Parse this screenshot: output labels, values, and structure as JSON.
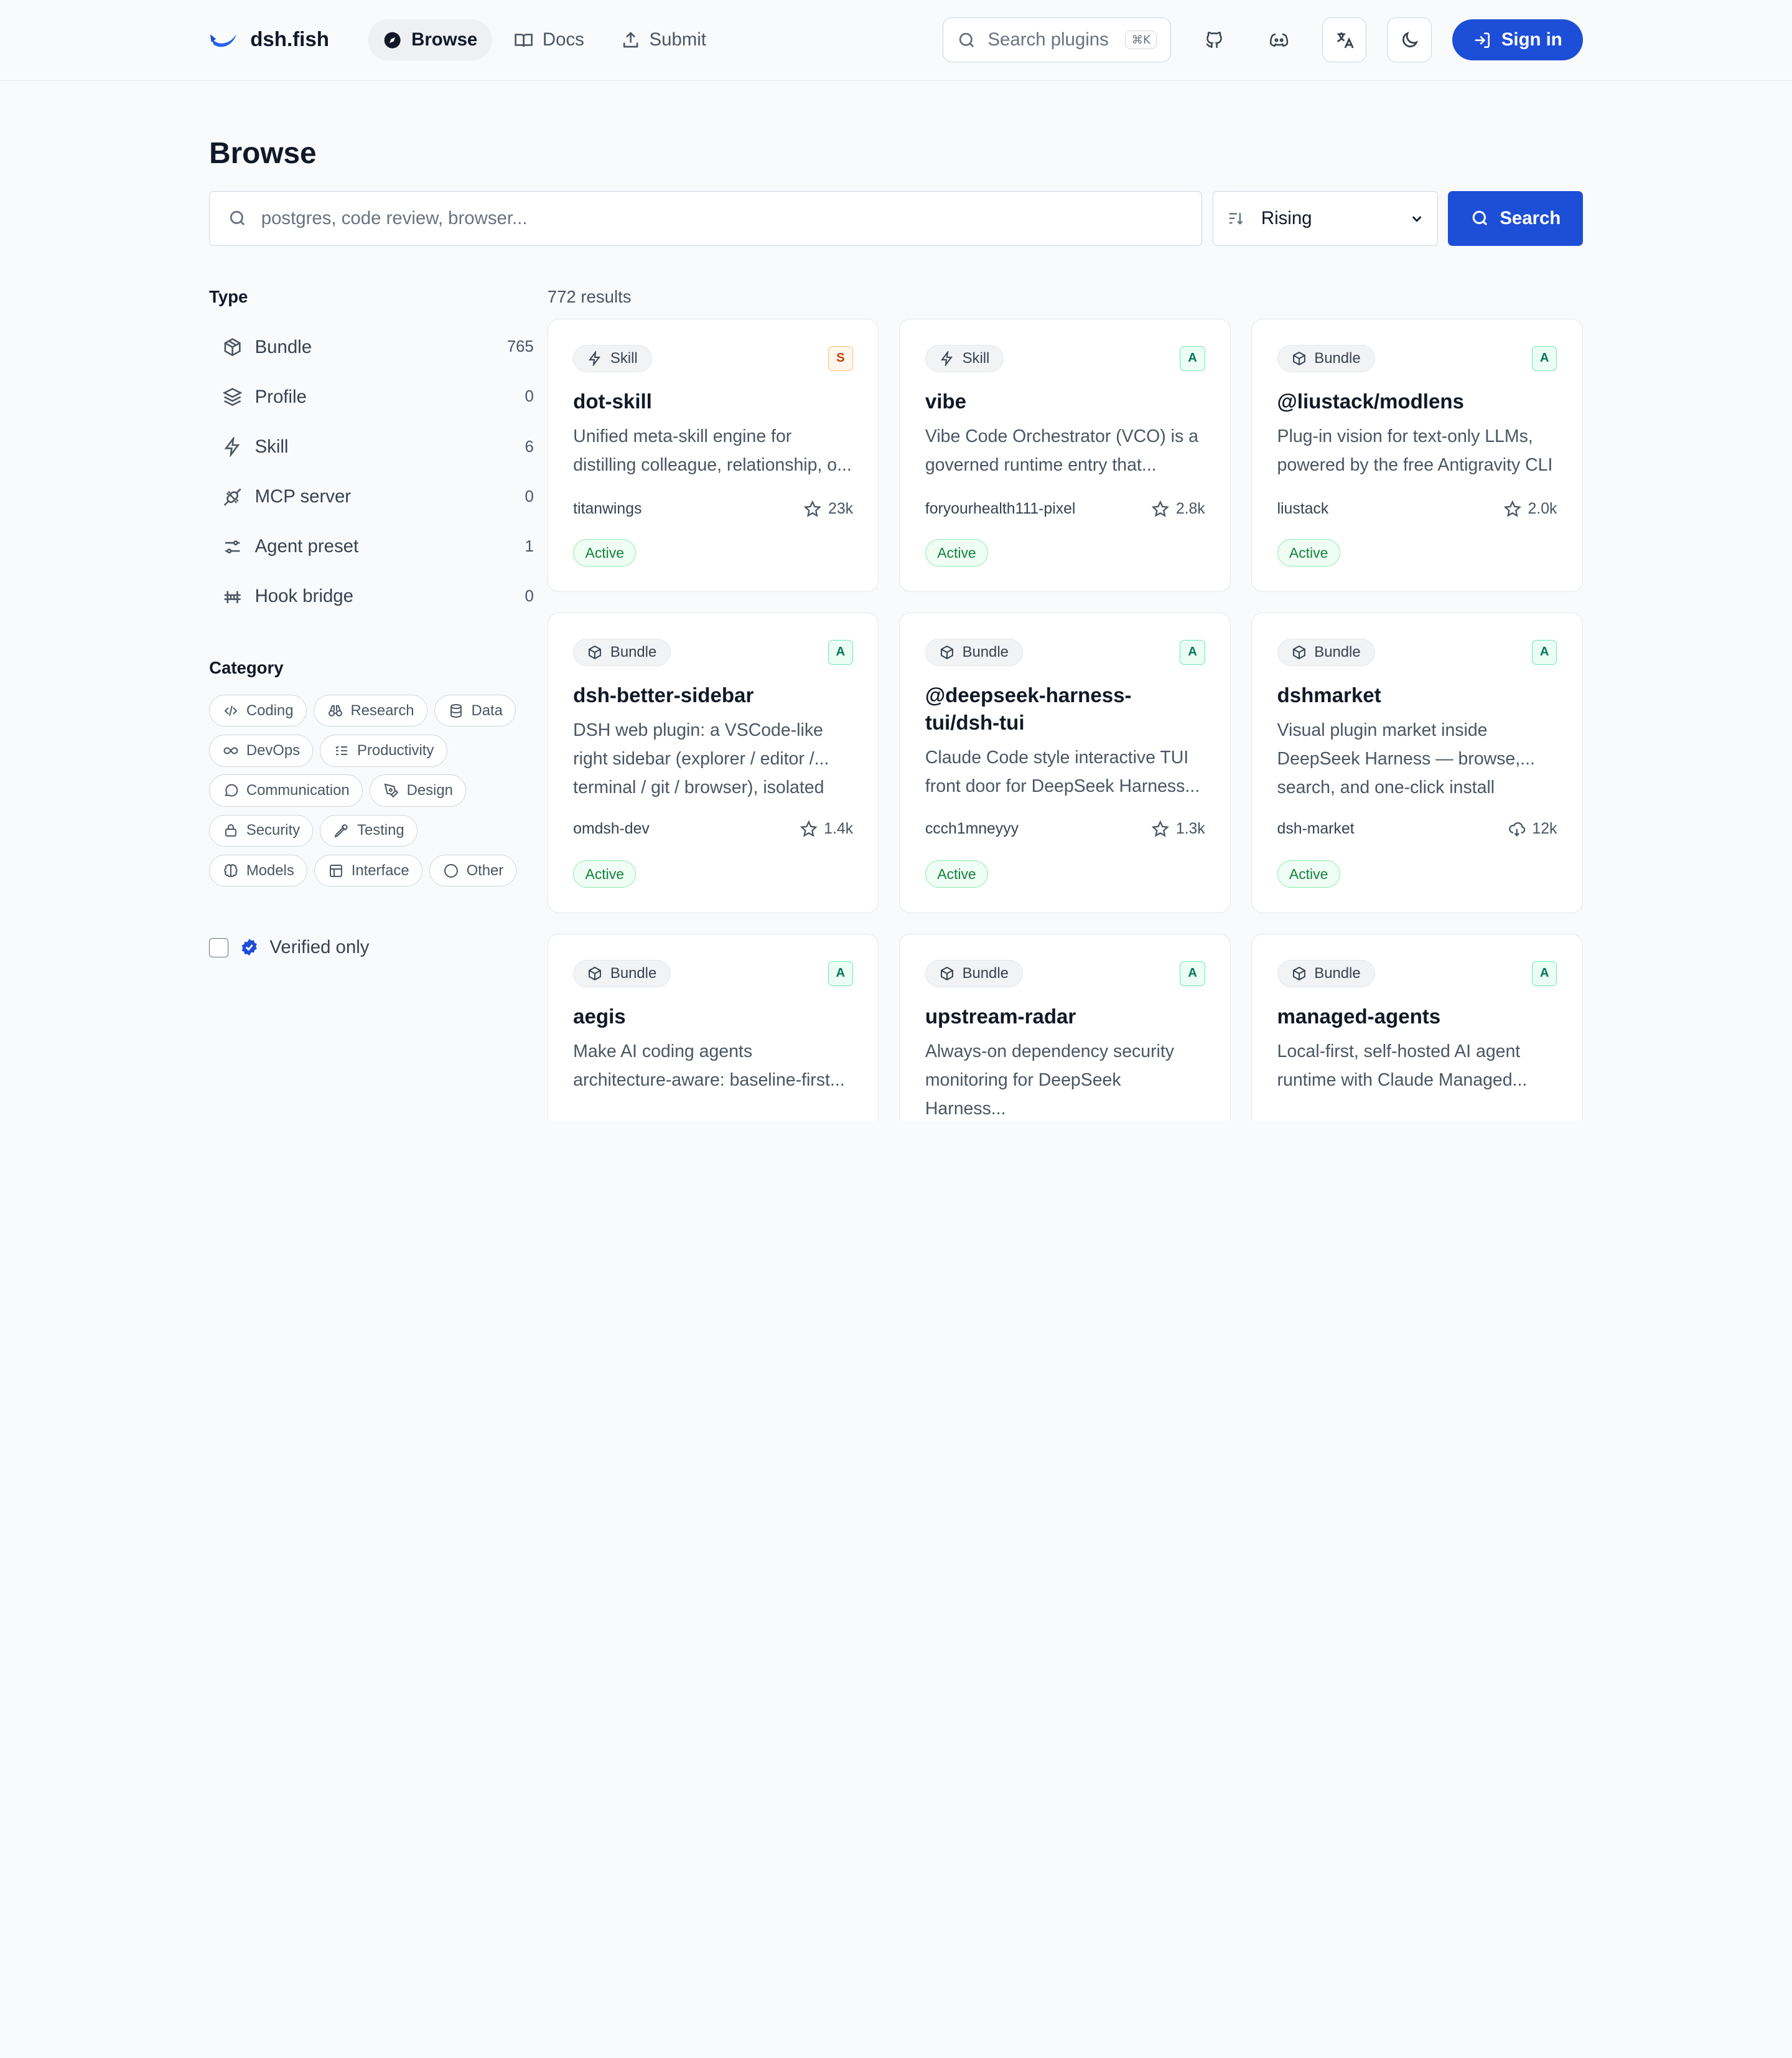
{
  "brand": {
    "name": "dsh.fish"
  },
  "nav": [
    {
      "label": "Browse",
      "icon": "compass-icon",
      "active": true
    },
    {
      "label": "Docs",
      "icon": "book-icon",
      "active": false
    },
    {
      "label": "Submit",
      "icon": "upload-icon",
      "active": false
    }
  ],
  "header": {
    "search_placeholder": "Search plugins",
    "search_shortcut": "⌘K",
    "icons": [
      "github-icon",
      "discord-icon",
      "translate-icon",
      "moon-icon"
    ],
    "signin_label": "Sign in"
  },
  "page": {
    "title": "Browse",
    "search_placeholder": "postgres, code review, browser...",
    "sort_value": "Rising",
    "search_button": "Search"
  },
  "sidebar": {
    "type_title": "Type",
    "types": [
      {
        "label": "Bundle",
        "count": "765",
        "icon": "cube-icon"
      },
      {
        "label": "Profile",
        "count": "0",
        "icon": "layers-icon"
      },
      {
        "label": "Skill",
        "count": "6",
        "icon": "bolt-icon"
      },
      {
        "label": "MCP server",
        "count": "0",
        "icon": "plug-icon"
      },
      {
        "label": "Agent preset",
        "count": "1",
        "icon": "sliders-icon"
      },
      {
        "label": "Hook bridge",
        "count": "0",
        "icon": "bridge-icon"
      }
    ],
    "category_title": "Category",
    "categories": [
      {
        "label": "Coding",
        "icon": "code-icon"
      },
      {
        "label": "Research",
        "icon": "binoculars-icon"
      },
      {
        "label": "Data",
        "icon": "database-icon"
      },
      {
        "label": "DevOps",
        "icon": "infinity-icon"
      },
      {
        "label": "Productivity",
        "icon": "list-check-icon"
      },
      {
        "label": "Communication",
        "icon": "chat-icon"
      },
      {
        "label": "Design",
        "icon": "pen-icon"
      },
      {
        "label": "Security",
        "icon": "lock-icon"
      },
      {
        "label": "Testing",
        "icon": "pipette-icon"
      },
      {
        "label": "Models",
        "icon": "brain-icon"
      },
      {
        "label": "Interface",
        "icon": "layout-icon"
      },
      {
        "label": "Other",
        "icon": "dots-icon"
      }
    ],
    "verified_label": "Verified only"
  },
  "results": {
    "count": "772 results",
    "cards": [
      {
        "type": "Skill",
        "grade": "S",
        "name": "dot-skill",
        "desc": "Unified meta-skill engine for distilling colleague, relationship, o...",
        "author": "titanwings",
        "stat": "23k",
        "stat_icon": "star-icon",
        "status": "Active"
      },
      {
        "type": "Skill",
        "grade": "A",
        "name": "vibe",
        "desc": "Vibe Code Orchestrator (VCO) is a governed runtime entry that...",
        "author": "foryourhealth111-pixel",
        "stat": "2.8k",
        "stat_icon": "star-icon",
        "status": "Active"
      },
      {
        "type": "Bundle",
        "grade": "A",
        "name": "@liustack/modlens",
        "desc": "Plug-in vision for text-only LLMs, powered by the free Antigravity CLI",
        "author": "liustack",
        "stat": "2.0k",
        "stat_icon": "star-icon",
        "status": "Active"
      },
      {
        "type": "Bundle",
        "grade": "A",
        "name": "dsh-better-sidebar",
        "desc": "DSH web plugin: a VSCode-like right sidebar (explorer / editor /... terminal / git / browser), isolated",
        "author": "omdsh-dev",
        "stat": "1.4k",
        "stat_icon": "star-icon",
        "status": "Active"
      },
      {
        "type": "Bundle",
        "grade": "A",
        "name": "@deepseek-harness-tui/dsh-tui",
        "desc": "Claude Code style interactive TUI front door for DeepSeek Harness...",
        "author": "ccch1mneyyy",
        "stat": "1.3k",
        "stat_icon": "star-icon",
        "status": "Active"
      },
      {
        "type": "Bundle",
        "grade": "A",
        "name": "dshmarket",
        "desc": "Visual plugin market inside DeepSeek Harness — browse,... search, and one-click install",
        "author": "dsh-market",
        "stat": "12k",
        "stat_icon": "download-cloud-icon",
        "status": "Active"
      },
      {
        "type": "Bundle",
        "grade": "A",
        "name": "aegis",
        "desc": "Make AI coding agents architecture-aware: baseline-first...",
        "author": "",
        "stat": "",
        "stat_icon": "",
        "status": ""
      },
      {
        "type": "Bundle",
        "grade": "A",
        "name": "upstream-radar",
        "desc": "Always-on dependency security monitoring for DeepSeek Harness...",
        "author": "",
        "stat": "",
        "stat_icon": "",
        "status": ""
      },
      {
        "type": "Bundle",
        "grade": "A",
        "name": "managed-agents",
        "desc": "Local-first, self-hosted AI agent runtime with Claude Managed...",
        "author": "",
        "stat": "",
        "stat_icon": "",
        "status": ""
      }
    ]
  },
  "colors": {
    "accent": "#1d4ed8",
    "active_status": "#15803d",
    "grade_a": "#047857",
    "grade_s": "#c2410c"
  }
}
